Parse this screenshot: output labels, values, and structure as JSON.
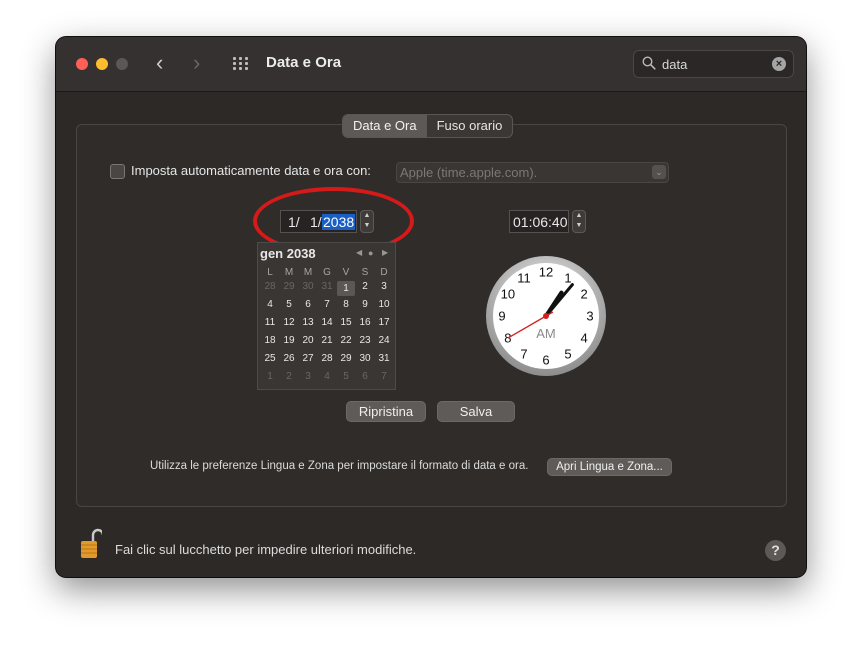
{
  "titlebar": {
    "title": "Data e Ora",
    "back_icon": "chevron-left-icon",
    "forward_icon": "chevron-right-icon",
    "show_all_icon": "grid-icon"
  },
  "search": {
    "value": "data",
    "icon": "search-icon",
    "clear_icon": "clear-icon"
  },
  "tabs": [
    {
      "label": "Data e Ora",
      "active": true
    },
    {
      "label": "Fuso orario",
      "active": false
    }
  ],
  "auto_time": {
    "label": "Imposta automaticamente data e ora con:",
    "checked": false,
    "server": "Apple (time.apple.com)."
  },
  "date": {
    "month": "1/",
    "day": "1/",
    "year": "2038"
  },
  "calendar": {
    "month_label": "gen 2038",
    "weekdays": [
      "L",
      "M",
      "M",
      "G",
      "V",
      "S",
      "D"
    ],
    "weeks": [
      [
        "28",
        "29",
        "30",
        "31",
        "1",
        "2",
        "3"
      ],
      [
        "4",
        "5",
        "6",
        "7",
        "8",
        "9",
        "10"
      ],
      [
        "11",
        "12",
        "13",
        "14",
        "15",
        "16",
        "17"
      ],
      [
        "18",
        "19",
        "20",
        "21",
        "22",
        "23",
        "24"
      ],
      [
        "25",
        "26",
        "27",
        "28",
        "29",
        "30",
        "31"
      ],
      [
        "1",
        "2",
        "3",
        "4",
        "5",
        "6",
        "7"
      ]
    ],
    "selected_day": "1"
  },
  "time": {
    "value": "01:06:40",
    "clock": {
      "numbers": [
        "12",
        "1",
        "2",
        "3",
        "4",
        "5",
        "6",
        "7",
        "8",
        "9",
        "10",
        "11"
      ],
      "period": "AM",
      "hour": 1,
      "minute": 6,
      "second": 40
    }
  },
  "buttons": {
    "reset": "Ripristina",
    "save": "Salva"
  },
  "footer": {
    "text": "Utilizza le preferenze Lingua e Zona per impostare il formato di data e ora.",
    "button": "Apri Lingua e Zona..."
  },
  "lock": {
    "text": "Fai clic sul lucchetto per impedire ulteriori modifiche.",
    "icon": "lock-icon"
  },
  "help": {
    "label": "?"
  },
  "colors": {
    "accent": "#1a5fc4",
    "highlight": "#d51a1a",
    "second_hand": "#d02020"
  }
}
